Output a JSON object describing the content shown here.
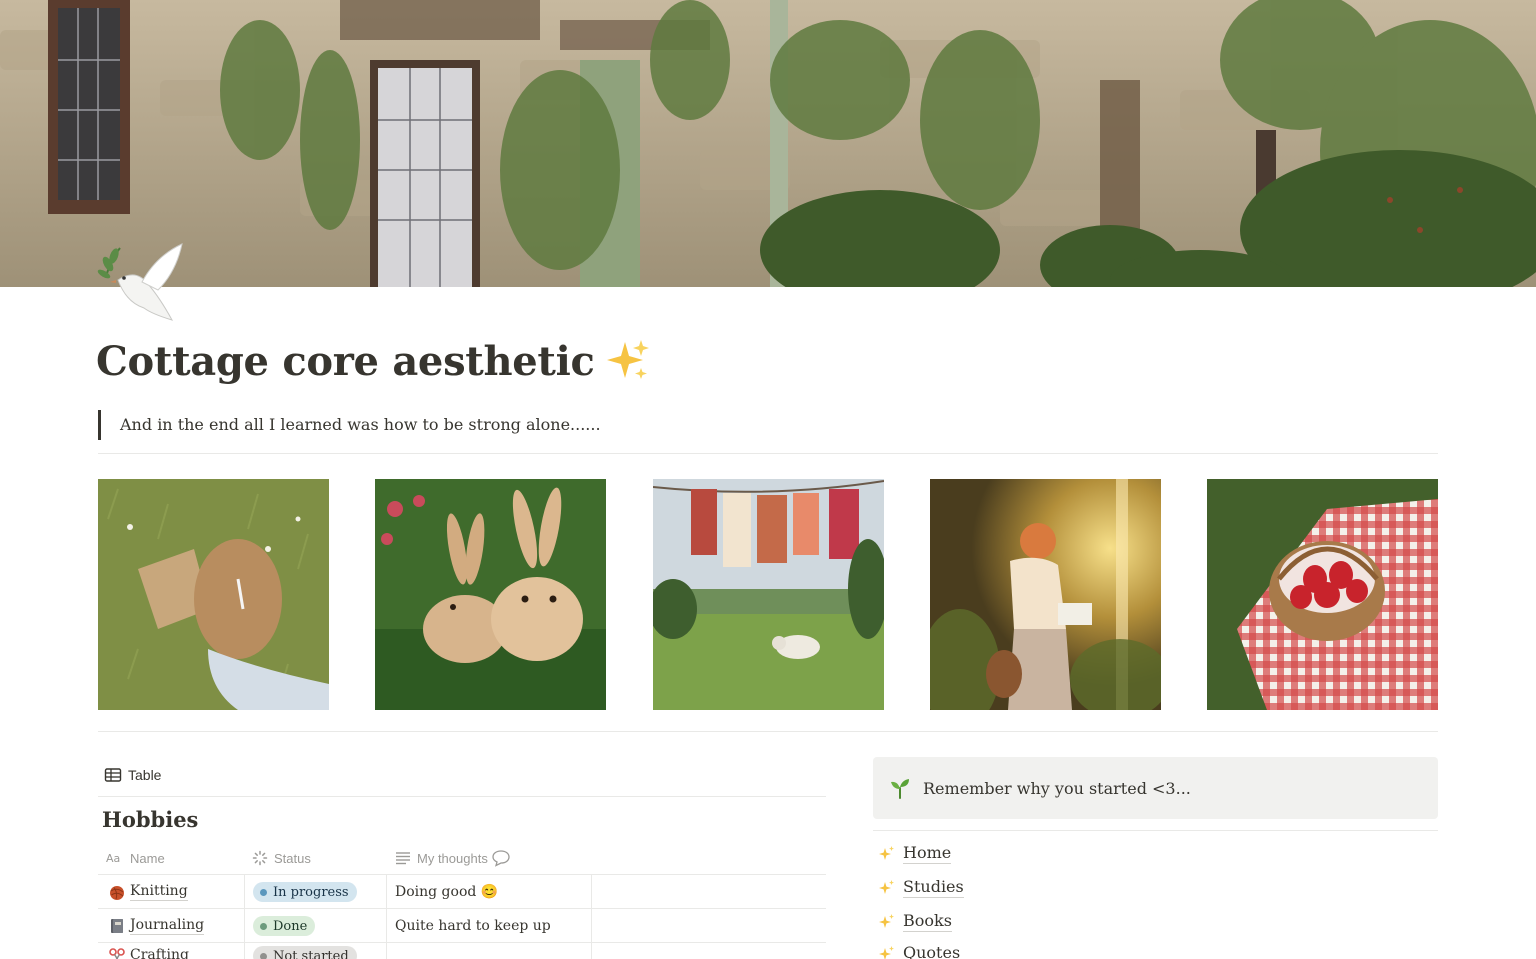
{
  "page": {
    "title": "Cottage core aesthetic",
    "title_emoji": "sparkles-icon",
    "icon": "dove-icon",
    "quote": "And in the end all I learned was how to be strong alone......"
  },
  "gallery": [
    {
      "icon": "girl-reading-in-grass-photo"
    },
    {
      "icon": "two-bunnies-photo"
    },
    {
      "icon": "clothesline-meadow-photo"
    },
    {
      "icon": "girl-reading-in-sunlight-photo"
    },
    {
      "icon": "strawberry-basket-picnic-photo"
    }
  ],
  "database": {
    "view_label": "Table",
    "title": "Hobbies",
    "columns": {
      "name": "Name",
      "status": "Status",
      "thoughts": "My thoughts"
    },
    "rows": [
      {
        "icon": "yarn-icon",
        "name": "Knitting",
        "status": "In progress",
        "status_color": "#d3e5ef",
        "dot_color": "#5b97bd",
        "thoughts": "Doing good 😊"
      },
      {
        "icon": "notebook-icon",
        "name": "Journaling",
        "status": "Done",
        "status_color": "#dbeddb",
        "dot_color": "#6c9b7d",
        "thoughts": "Quite hard to keep up"
      },
      {
        "icon": "scissors-icon",
        "name": "Crafting",
        "status": "Not started",
        "status_color": "#e3e2e0",
        "dot_color": "#91918e",
        "thoughts": ""
      }
    ]
  },
  "callout": {
    "icon": "seedling-icon",
    "text": "Remember why you started <3..."
  },
  "nav": [
    {
      "icon": "sparkles-icon",
      "label": "Home"
    },
    {
      "icon": "sparkles-icon",
      "label": "Studies"
    },
    {
      "icon": "sparkles-icon",
      "label": "Books"
    },
    {
      "icon": "sparkles-icon",
      "label": "Quotes"
    }
  ]
}
